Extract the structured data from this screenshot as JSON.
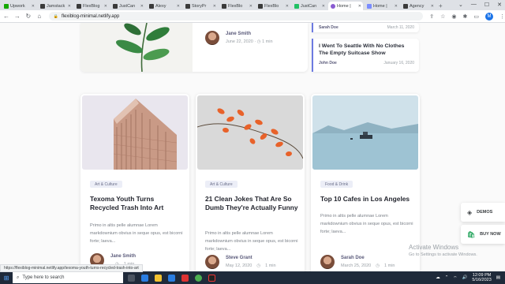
{
  "browser": {
    "tabs": [
      {
        "label": "Upwork",
        "color": "#14a800"
      },
      {
        "label": "Jamstack",
        "color": "#3a3a3a"
      },
      {
        "label": "FlexBlog",
        "color": "#3a3a3a"
      },
      {
        "label": "JustCan",
        "color": "#3a3a3a"
      },
      {
        "label": "Alexy",
        "color": "#3a3a3a"
      },
      {
        "label": "StoryPr",
        "color": "#3a3a3a"
      },
      {
        "label": "FlexBlo",
        "color": "#3a3a3a"
      },
      {
        "label": "FlexBlo",
        "color": "#3a3a3a"
      },
      {
        "label": "JustCan",
        "color": "#21c064"
      },
      {
        "label": "Home |",
        "color": "#8a5cd1",
        "active": true
      },
      {
        "label": "Home |",
        "color": "#7a8cff"
      },
      {
        "label": "Agency",
        "color": "#3a3a3a"
      }
    ],
    "url": "flexiblog-minimal.netlify.app",
    "profile_initial": "M"
  },
  "top": {
    "author": "Jane Smith",
    "date": "June 22, 2020",
    "read_time": "1 min"
  },
  "side": {
    "card_a": {
      "author": "Sarah Doe",
      "date": "March 11, 2020"
    },
    "card_b": {
      "title": "I Went To Seattle With No Clothes The Empty Suitcase Show",
      "author": "John Doe",
      "date": "January 16, 2020"
    }
  },
  "cards": [
    {
      "category": "Art & Culture",
      "title": "Texoma Youth Turns Recycled Trash Into Art",
      "excerpt": "Primo in altis pelle alumnae Lorem markdownium obvius in seque opus, est bicorni forte; laeva...",
      "author": "Jane Smith",
      "date": "",
      "read_time": "1 min"
    },
    {
      "category": "Art & Culture",
      "title": "21 Clean Jokes That Are So Dumb They're Actually Funny",
      "excerpt": "Primo in altis pelle alumnae Lorem markdownium obvius in seque opus, est bicorni forte; laeva...",
      "author": "Steve Grant",
      "date": "May 12, 2020",
      "read_time": "1 min"
    },
    {
      "category": "Food & Drink",
      "title": "Top 10 Cafes in Los Angeles",
      "excerpt": "Primo in altis pelle alumnae Lorem markdownium obvius in seque opus, est bicorni forte; laeva...",
      "author": "Sarah Doe",
      "date": "March 25, 2020",
      "read_time": "1 min"
    }
  ],
  "widgets": {
    "demos": "DEMOS",
    "buy_now": "BUY NOW"
  },
  "activate": {
    "heading": "Activate Windows",
    "sub": "Go to Settings to activate Windows."
  },
  "status_url": "https://flexiblog-minimal.netlify.app/texoma-youth-turns-recycled-trash-into-art",
  "taskbar": {
    "search_placeholder": "Type here to search",
    "time": "12:09 PM",
    "date": "5/16/2023"
  }
}
